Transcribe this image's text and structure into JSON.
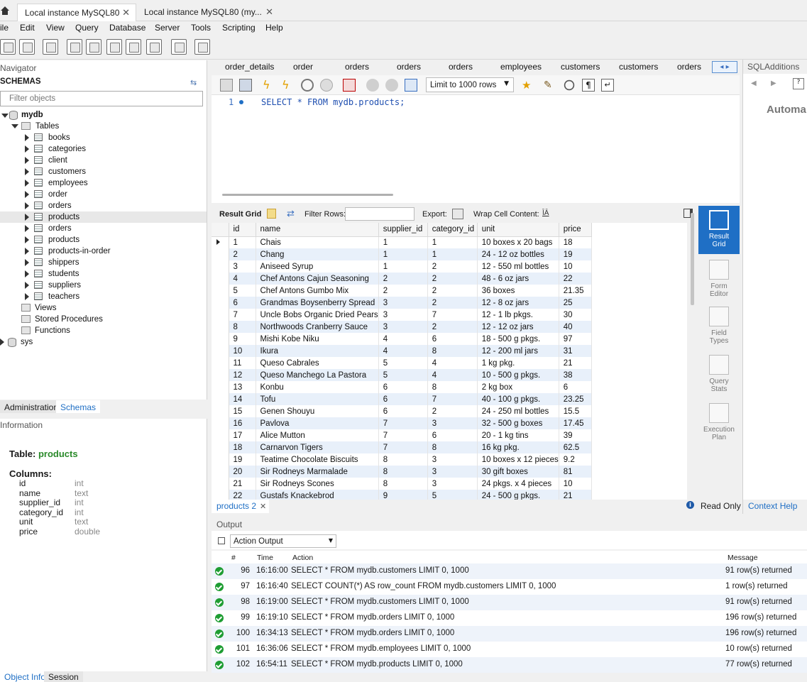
{
  "title_tabs": [
    "Local instance MySQL80",
    "Local instance MySQL80 (my..."
  ],
  "menu": [
    "ile",
    "Edit",
    "View",
    "Query",
    "Database",
    "Server",
    "Tools",
    "Scripting",
    "Help"
  ],
  "navigator": {
    "header": "Navigator",
    "schemas_label": "SCHEMAS",
    "filter_placeholder": "Filter objects",
    "db": "mydb",
    "tables_label": "Tables",
    "tables": [
      "books",
      "categories",
      "client",
      "customers",
      "employees",
      "order",
      "orders",
      "products",
      "orders",
      "products",
      "products-in-order",
      "shippers",
      "students",
      "suppliers",
      "teachers"
    ],
    "views_label": "Views",
    "procedures_label": "Stored Procedures",
    "functions_label": "Functions",
    "sys": "sys"
  },
  "left_tabs": {
    "administration": "Administration",
    "schemas": "Schemas"
  },
  "info": {
    "header": "Information",
    "table_label": "Table:",
    "table_name": "products",
    "columns_label": "Columns:",
    "columns": [
      {
        "name": "id",
        "type": "int"
      },
      {
        "name": "name",
        "type": "text"
      },
      {
        "name": "supplier_id",
        "type": "int"
      },
      {
        "name": "category_id",
        "type": "int"
      },
      {
        "name": "unit",
        "type": "text"
      },
      {
        "name": "price",
        "type": "double"
      }
    ]
  },
  "bottom_left_tabs": {
    "object_info": "Object Info",
    "session": "Session"
  },
  "editor_tabs": [
    "order_details",
    "order",
    "orders",
    "orders",
    "orders",
    "employees",
    "customers",
    "customers",
    "orders"
  ],
  "editor_toolbar": {
    "limit": "Limit to 1000 rows"
  },
  "editor": {
    "line_number": "1",
    "sql": "SELECT * FROM mydb.products;"
  },
  "result_toolbar": {
    "result_grid": "Result Grid",
    "filter_rows": "Filter Rows:",
    "export": "Export:",
    "wrap": "Wrap Cell Content:"
  },
  "grid": {
    "columns": [
      "id",
      "name",
      "supplier_id",
      "category_id",
      "unit",
      "price"
    ],
    "rows": [
      [
        "1",
        "Chais",
        "1",
        "1",
        "10 boxes x 20 bags",
        "18"
      ],
      [
        "2",
        "Chang",
        "1",
        "1",
        "24 - 12 oz bottles",
        "19"
      ],
      [
        "3",
        "Aniseed Syrup",
        "1",
        "2",
        "12 - 550 ml bottles",
        "10"
      ],
      [
        "4",
        "Chef Antons Cajun Seasoning",
        "2",
        "2",
        "48 - 6 oz jars",
        "22"
      ],
      [
        "5",
        "Chef Antons Gumbo Mix",
        "2",
        "2",
        "36 boxes",
        "21.35"
      ],
      [
        "6",
        "Grandmas Boysenberry Spread",
        "3",
        "2",
        "12 - 8 oz jars",
        "25"
      ],
      [
        "7",
        "Uncle Bobs Organic Dried Pears",
        "3",
        "7",
        "12 - 1 lb pkgs.",
        "30"
      ],
      [
        "8",
        "Northwoods Cranberry Sauce",
        "3",
        "2",
        "12 - 12 oz jars",
        "40"
      ],
      [
        "9",
        "Mishi Kobe Niku",
        "4",
        "6",
        "18 - 500 g pkgs.",
        "97"
      ],
      [
        "10",
        "Ikura",
        "4",
        "8",
        "12 - 200 ml jars",
        "31"
      ],
      [
        "11",
        "Queso Cabrales",
        "5",
        "4",
        "1 kg pkg.",
        "21"
      ],
      [
        "12",
        "Queso Manchego La Pastora",
        "5",
        "4",
        "10 - 500 g pkgs.",
        "38"
      ],
      [
        "13",
        "Konbu",
        "6",
        "8",
        "2 kg box",
        "6"
      ],
      [
        "14",
        "Tofu",
        "6",
        "7",
        "40 - 100 g pkgs.",
        "23.25"
      ],
      [
        "15",
        "Genen Shouyu",
        "6",
        "2",
        "24 - 250 ml bottles",
        "15.5"
      ],
      [
        "16",
        "Pavlova",
        "7",
        "3",
        "32 - 500 g boxes",
        "17.45"
      ],
      [
        "17",
        "Alice Mutton",
        "7",
        "6",
        "20 - 1 kg tins",
        "39"
      ],
      [
        "18",
        "Carnarvon Tigers",
        "7",
        "8",
        "16 kg pkg.",
        "62.5"
      ],
      [
        "19",
        "Teatime Chocolate Biscuits",
        "8",
        "3",
        "10 boxes x 12 pieces",
        "9.2"
      ],
      [
        "20",
        "Sir Rodneys Marmalade",
        "8",
        "3",
        "30 gift boxes",
        "81"
      ],
      [
        "21",
        "Sir Rodneys Scones",
        "8",
        "3",
        "24 pkgs. x 4 pieces",
        "10"
      ],
      [
        "22",
        "Gustafs Knackebrod",
        "9",
        "5",
        "24 - 500 g pkgs.",
        "21"
      ]
    ]
  },
  "side_panel": [
    "Result Grid",
    "Form Editor",
    "Field Types",
    "Query Stats",
    "Execution Plan"
  ],
  "result_tab": "products 2",
  "read_only": "Read Only",
  "sql_additions": {
    "header": "SQLAdditions",
    "automatic": "Automa",
    "context_help": "Context Help"
  },
  "output": {
    "header": "Output",
    "selector": "Action Output",
    "columns": [
      "#",
      "Time",
      "Action",
      "Message"
    ],
    "rows": [
      {
        "n": "96",
        "time": "16:16:00",
        "action": "SELECT * FROM mydb.customers LIMIT 0, 1000",
        "msg": "91 row(s) returned"
      },
      {
        "n": "97",
        "time": "16:16:40",
        "action": "SELECT COUNT(*) AS row_count FROM mydb.customers LIMIT 0, 1000",
        "msg": "1 row(s) returned"
      },
      {
        "n": "98",
        "time": "16:19:00",
        "action": "SELECT * FROM mydb.customers LIMIT 0, 1000",
        "msg": "91 row(s) returned"
      },
      {
        "n": "99",
        "time": "16:19:10",
        "action": "SELECT * FROM mydb.orders LIMIT 0, 1000",
        "msg": "196 row(s) returned"
      },
      {
        "n": "100",
        "time": "16:34:13",
        "action": "SELECT * FROM mydb.orders LIMIT 0, 1000",
        "msg": "196 row(s) returned"
      },
      {
        "n": "101",
        "time": "16:36:06",
        "action": "SELECT * FROM mydb.employees LIMIT 0, 1000",
        "msg": "10 row(s) returned"
      },
      {
        "n": "102",
        "time": "16:54:11",
        "action": "SELECT * FROM mydb.products LIMIT 0, 1000",
        "msg": "77 row(s) returned"
      }
    ]
  },
  "colors": {
    "accent": "#1f6fc5",
    "ok": "#1e9d32",
    "green_text": "#2a8a2a",
    "row_alt": "#e8f0fa"
  }
}
